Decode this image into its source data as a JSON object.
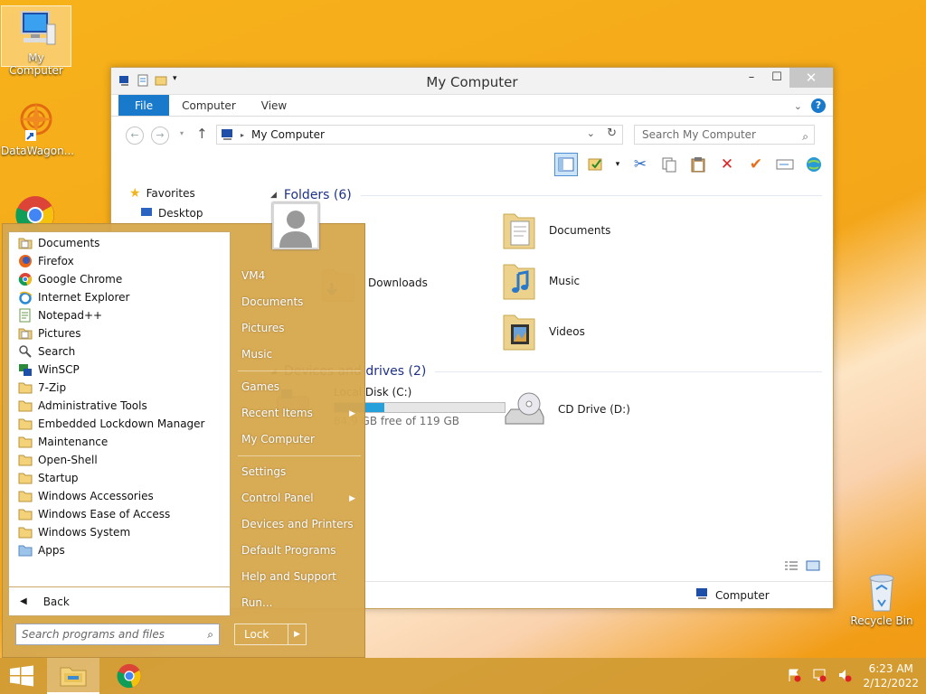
{
  "desktop": {
    "icons": [
      {
        "label": "My Computer"
      },
      {
        "label": "DataWagon..."
      },
      {
        "label": "Recycle Bin"
      }
    ]
  },
  "explorer": {
    "title": "My Computer",
    "ribbon_tabs": {
      "file": "File",
      "computer": "Computer",
      "view": "View"
    },
    "address": "My Computer",
    "search_placeholder": "Search My Computer",
    "nav": {
      "favorites": "Favorites",
      "desktop": "Desktop"
    },
    "folders_header": "Folders (6)",
    "folders": {
      "documents": "Documents",
      "music": "Music",
      "videos": "Videos",
      "downloads_partial": "Downloads"
    },
    "drives_header": "Devices and drives (2)",
    "drive_c": {
      "label": "Local Disk (C:)",
      "free_text": "84.9 GB free of 119 GB",
      "used_fraction": 0.29
    },
    "drive_d": {
      "label": "CD Drive (D:)"
    },
    "status_location": "Computer"
  },
  "start_menu": {
    "programs": [
      {
        "label": "Documents",
        "icon": "library-icon"
      },
      {
        "label": "Firefox",
        "icon": "firefox-icon"
      },
      {
        "label": "Google Chrome",
        "icon": "chrome-icon"
      },
      {
        "label": "Internet Explorer",
        "icon": "ie-icon"
      },
      {
        "label": "Notepad++",
        "icon": "notepad-icon"
      },
      {
        "label": "Pictures",
        "icon": "library-icon"
      },
      {
        "label": "Search",
        "icon": "search-icon"
      },
      {
        "label": "WinSCP",
        "icon": "winscp-icon"
      },
      {
        "label": "7-Zip",
        "icon": "folder-icon"
      },
      {
        "label": "Administrative Tools",
        "icon": "folder-icon"
      },
      {
        "label": "Embedded Lockdown Manager",
        "icon": "folder-icon"
      },
      {
        "label": "Maintenance",
        "icon": "folder-icon"
      },
      {
        "label": "Open-Shell",
        "icon": "folder-icon"
      },
      {
        "label": "Startup",
        "icon": "folder-icon"
      },
      {
        "label": "Windows Accessories",
        "icon": "folder-icon"
      },
      {
        "label": "Windows Ease of Access",
        "icon": "folder-icon"
      },
      {
        "label": "Windows System",
        "icon": "folder-icon"
      },
      {
        "label": "Apps",
        "icon": "apps-icon"
      }
    ],
    "back": "Back",
    "search_placeholder": "Search programs and files",
    "right": {
      "user": "VM4",
      "documents": "Documents",
      "pictures": "Pictures",
      "music": "Music",
      "games": "Games",
      "recent": "Recent Items",
      "computer": "My Computer",
      "settings": "Settings",
      "control_panel": "Control Panel",
      "devices": "Devices and Printers",
      "defaults": "Default Programs",
      "help": "Help and Support",
      "run": "Run..."
    },
    "lock": "Lock"
  },
  "taskbar": {
    "time": "6:23 AM",
    "date": "2/12/2022"
  },
  "colors": {
    "accent": "#1979ca",
    "menu": "#d6a84e",
    "desktop": "#f5a81a"
  }
}
